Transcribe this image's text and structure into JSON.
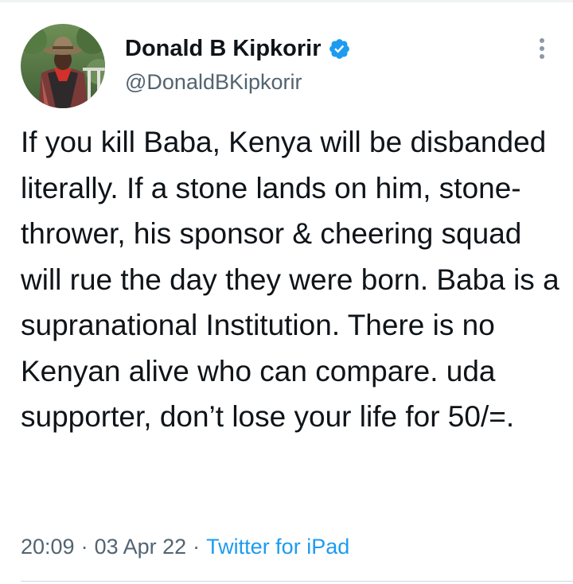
{
  "author": {
    "display_name": "Donald B Kipkorir",
    "handle": "@DonaldBKipkorir",
    "verified": true,
    "avatar_icon": "profile-photo",
    "verified_icon": "verified-badge-icon",
    "verified_color": "#1d9bf0"
  },
  "tweet": {
    "text": "If you kill Baba, Kenya will be disbanded literally. If a stone lands on him, stone-thrower, his sponsor & cheering squad will rue the day they were born. Baba is a supranational Institution. There is no Kenyan alive who can compare. uda supporter, don’t lose your life for 50/=.",
    "time": "20:09",
    "date": "03 Apr 22",
    "source": "Twitter for iPad",
    "separator": "·"
  },
  "menu": {
    "more_icon": "vertical-ellipsis-icon"
  },
  "colors": {
    "text_primary": "#0f1419",
    "text_secondary": "#536471",
    "link": "#1d9bf0",
    "divider": "#cfd9de"
  }
}
